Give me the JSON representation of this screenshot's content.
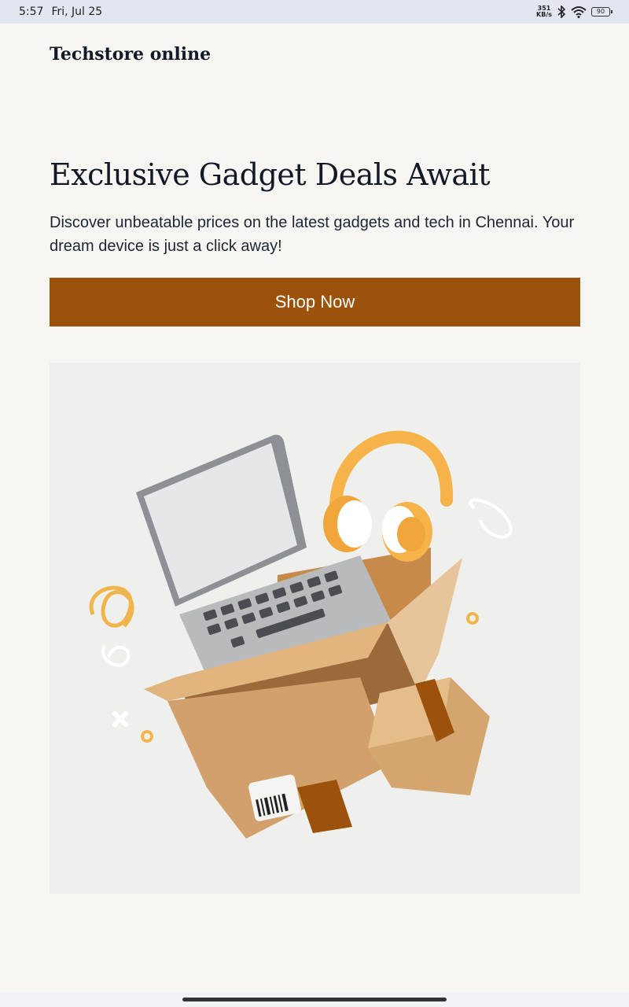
{
  "status_bar": {
    "time": "5:57",
    "date": "Fri, Jul 25",
    "net_speed_value": "351",
    "net_speed_unit": "KB/s",
    "battery": "90",
    "icons": [
      "bluetooth-icon",
      "wifi-icon",
      "battery-icon"
    ]
  },
  "header": {
    "brand": "Techstore online"
  },
  "hero": {
    "title": "Exclusive Gadget Deals Await",
    "description": "Discover unbeatable prices on the latest gadgets and tech in Chennai. Your dream device is just a click away!",
    "cta_label": "Shop Now",
    "image_subject": "laptop and headphones in open cardboard box illustration"
  },
  "colors": {
    "accent": "#9c520b",
    "background": "#f7f6f3",
    "image_bg": "#efefee"
  }
}
